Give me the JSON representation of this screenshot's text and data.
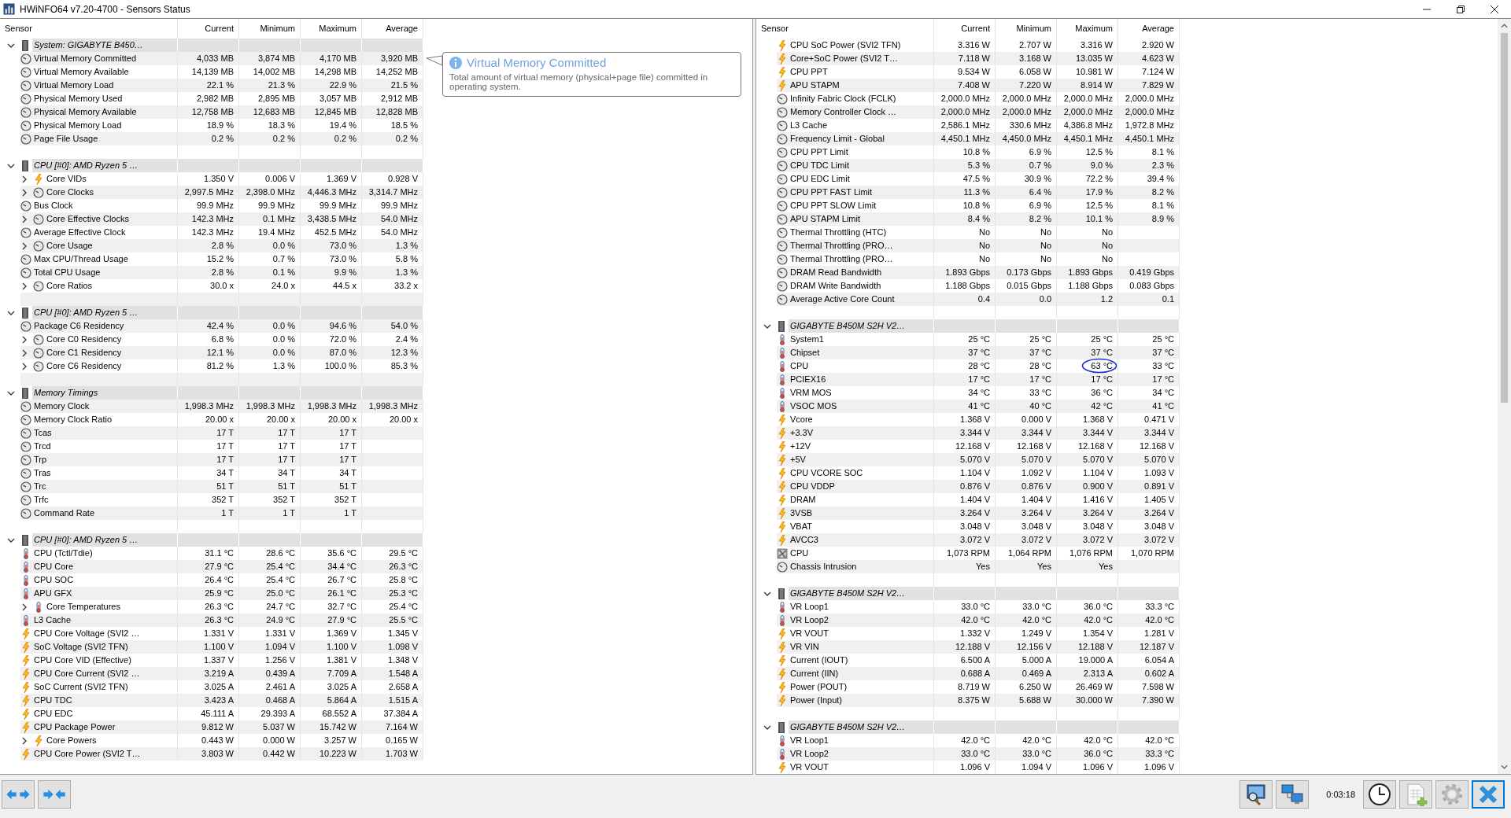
{
  "window": {
    "title": "HWiNFO64 v7.20-4700 - Sensors Status"
  },
  "panes": [
    {
      "columns": [
        "Sensor",
        "Current",
        "Minimum",
        "Maximum",
        "Average"
      ],
      "tooltip": {
        "title": "Virtual Memory Committed",
        "text": "Total amount of virtual memory (physical+page file) committed in operating system."
      },
      "groups": [
        {
          "title": "System: GIGABYTE B450…",
          "expanded": true,
          "rows": [
            {
              "label": "Virtual Memory Committed",
              "kind": "clock",
              "expandable": false,
              "values": [
                "4,033 MB",
                "3,874 MB",
                "4,170 MB",
                "3,920 MB"
              ]
            },
            {
              "label": "Virtual Memory Available",
              "kind": "clock",
              "expandable": false,
              "values": [
                "14,139 MB",
                "14,002 MB",
                "14,298 MB",
                "14,252 MB"
              ]
            },
            {
              "label": "Virtual Memory Load",
              "kind": "clock",
              "expandable": false,
              "values": [
                "22.1 %",
                "21.3 %",
                "22.9 %",
                "21.5 %"
              ]
            },
            {
              "label": "Physical Memory Used",
              "kind": "clock",
              "expandable": false,
              "values": [
                "2,982 MB",
                "2,895 MB",
                "3,057 MB",
                "2,912 MB"
              ]
            },
            {
              "label": "Physical Memory Available",
              "kind": "clock",
              "expandable": false,
              "values": [
                "12,758 MB",
                "12,683 MB",
                "12,845 MB",
                "12,828 MB"
              ]
            },
            {
              "label": "Physical Memory Load",
              "kind": "clock",
              "expandable": false,
              "values": [
                "18.9 %",
                "18.3 %",
                "19.4 %",
                "18.5 %"
              ]
            },
            {
              "label": "Page File Usage",
              "kind": "clock",
              "expandable": false,
              "values": [
                "0.2 %",
                "0.2 %",
                "0.2 %",
                "0.2 %"
              ]
            }
          ]
        },
        {
          "title": "CPU [#0]: AMD Ryzen 5 …",
          "expanded": true,
          "rows": [
            {
              "label": "Core VIDs",
              "kind": "bolt",
              "expandable": true,
              "values": [
                "1.350 V",
                "0.006 V",
                "1.369 V",
                "0.928 V"
              ]
            },
            {
              "label": "Core Clocks",
              "kind": "clock",
              "expandable": true,
              "values": [
                "2,997.5 MHz",
                "2,398.0 MHz",
                "4,446.3 MHz",
                "3,314.7 MHz"
              ]
            },
            {
              "label": "Bus Clock",
              "kind": "clock",
              "expandable": false,
              "values": [
                "99.9 MHz",
                "99.9 MHz",
                "99.9 MHz",
                "99.9 MHz"
              ]
            },
            {
              "label": "Core Effective Clocks",
              "kind": "clock",
              "expandable": true,
              "values": [
                "142.3 MHz",
                "0.1 MHz",
                "3,438.5 MHz",
                "54.0 MHz"
              ]
            },
            {
              "label": "Average Effective Clock",
              "kind": "clock",
              "expandable": false,
              "values": [
                "142.3 MHz",
                "19.4 MHz",
                "452.5 MHz",
                "54.0 MHz"
              ]
            },
            {
              "label": "Core Usage",
              "kind": "clock",
              "expandable": true,
              "values": [
                "2.8 %",
                "0.0 %",
                "73.0 %",
                "1.3 %"
              ]
            },
            {
              "label": "Max CPU/Thread Usage",
              "kind": "clock",
              "expandable": false,
              "values": [
                "15.2 %",
                "0.7 %",
                "73.0 %",
                "5.8 %"
              ]
            },
            {
              "label": "Total CPU Usage",
              "kind": "clock",
              "expandable": false,
              "values": [
                "2.8 %",
                "0.1 %",
                "9.9 %",
                "1.3 %"
              ]
            },
            {
              "label": "Core Ratios",
              "kind": "clock",
              "expandable": true,
              "values": [
                "30.0 x",
                "24.0 x",
                "44.5 x",
                "33.2 x"
              ]
            }
          ]
        },
        {
          "title": "CPU [#0]: AMD Ryzen 5 …",
          "expanded": true,
          "rows": [
            {
              "label": "Package C6 Residency",
              "kind": "clock",
              "expandable": false,
              "values": [
                "42.4 %",
                "0.0 %",
                "94.6 %",
                "54.0 %"
              ]
            },
            {
              "label": "Core C0 Residency",
              "kind": "clock",
              "expandable": true,
              "values": [
                "6.8 %",
                "0.0 %",
                "72.0 %",
                "2.4 %"
              ]
            },
            {
              "label": "Core C1 Residency",
              "kind": "clock",
              "expandable": true,
              "values": [
                "12.1 %",
                "0.0 %",
                "87.0 %",
                "12.3 %"
              ]
            },
            {
              "label": "Core C6 Residency",
              "kind": "clock",
              "expandable": true,
              "values": [
                "81.2 %",
                "1.3 %",
                "100.0 %",
                "85.3 %"
              ]
            }
          ]
        },
        {
          "title": "Memory Timings",
          "expanded": true,
          "rows": [
            {
              "label": "Memory Clock",
              "kind": "clock",
              "expandable": false,
              "values": [
                "1,998.3 MHz",
                "1,998.3 MHz",
                "1,998.3 MHz",
                "1,998.3 MHz"
              ]
            },
            {
              "label": "Memory Clock Ratio",
              "kind": "clock",
              "expandable": false,
              "values": [
                "20.00 x",
                "20.00 x",
                "20.00 x",
                "20.00 x"
              ]
            },
            {
              "label": "Tcas",
              "kind": "clock",
              "expandable": false,
              "values": [
                "17 T",
                "17 T",
                "17 T"
              ]
            },
            {
              "label": "Trcd",
              "kind": "clock",
              "expandable": false,
              "values": [
                "17 T",
                "17 T",
                "17 T"
              ]
            },
            {
              "label": "Trp",
              "kind": "clock",
              "expandable": false,
              "values": [
                "17 T",
                "17 T",
                "17 T"
              ]
            },
            {
              "label": "Tras",
              "kind": "clock",
              "expandable": false,
              "values": [
                "34 T",
                "34 T",
                "34 T"
              ]
            },
            {
              "label": "Trc",
              "kind": "clock",
              "expandable": false,
              "values": [
                "51 T",
                "51 T",
                "51 T"
              ]
            },
            {
              "label": "Trfc",
              "kind": "clock",
              "expandable": false,
              "values": [
                "352 T",
                "352 T",
                "352 T"
              ]
            },
            {
              "label": "Command Rate",
              "kind": "clock",
              "expandable": false,
              "values": [
                "1 T",
                "1 T",
                "1 T"
              ]
            }
          ]
        },
        {
          "title": "CPU [#0]: AMD Ryzen 5 …",
          "expanded": true,
          "rows": [
            {
              "label": "CPU (Tctl/Tdie)",
              "kind": "thermo",
              "expandable": false,
              "values": [
                "31.1 °C",
                "28.6 °C",
                "35.6 °C",
                "29.5 °C"
              ]
            },
            {
              "label": "CPU Core",
              "kind": "thermo",
              "expandable": false,
              "values": [
                "27.9 °C",
                "25.4 °C",
                "34.4 °C",
                "26.3 °C"
              ]
            },
            {
              "label": "CPU SOC",
              "kind": "thermo",
              "expandable": false,
              "values": [
                "26.4 °C",
                "25.4 °C",
                "26.7 °C",
                "25.8 °C"
              ]
            },
            {
              "label": "APU GFX",
              "kind": "thermo",
              "expandable": false,
              "values": [
                "25.9 °C",
                "25.0 °C",
                "26.1 °C",
                "25.3 °C"
              ]
            },
            {
              "label": "Core Temperatures",
              "kind": "thermo",
              "expandable": true,
              "values": [
                "26.3 °C",
                "24.7 °C",
                "32.7 °C",
                "25.4 °C"
              ]
            },
            {
              "label": "L3 Cache",
              "kind": "thermo",
              "expandable": false,
              "values": [
                "26.3 °C",
                "24.9 °C",
                "27.9 °C",
                "25.5 °C"
              ]
            },
            {
              "label": "CPU Core Voltage (SVI2 …",
              "kind": "bolt",
              "expandable": false,
              "values": [
                "1.331 V",
                "1.331 V",
                "1.369 V",
                "1.345 V"
              ]
            },
            {
              "label": "SoC Voltage (SVI2 TFN)",
              "kind": "bolt",
              "expandable": false,
              "values": [
                "1.100 V",
                "1.094 V",
                "1.100 V",
                "1.098 V"
              ]
            },
            {
              "label": "CPU Core VID (Effective)",
              "kind": "bolt",
              "expandable": false,
              "values": [
                "1.337 V",
                "1.256 V",
                "1.381 V",
                "1.348 V"
              ]
            },
            {
              "label": "CPU Core Current (SVI2 …",
              "kind": "bolt",
              "expandable": false,
              "values": [
                "3.219 A",
                "0.439 A",
                "7.709 A",
                "1.548 A"
              ]
            },
            {
              "label": "SoC Current (SVI2 TFN)",
              "kind": "bolt",
              "expandable": false,
              "values": [
                "3.025 A",
                "2.461 A",
                "3.025 A",
                "2.658 A"
              ]
            },
            {
              "label": "CPU TDC",
              "kind": "bolt",
              "expandable": false,
              "values": [
                "3.423 A",
                "0.468 A",
                "5.864 A",
                "1.515 A"
              ]
            },
            {
              "label": "CPU EDC",
              "kind": "bolt",
              "expandable": false,
              "values": [
                "45.111 A",
                "29.393 A",
                "68.552 A",
                "37.384 A"
              ]
            },
            {
              "label": "CPU Package Power",
              "kind": "bolt",
              "expandable": false,
              "values": [
                "9.812 W",
                "5.037 W",
                "15.742 W",
                "7.164 W"
              ]
            },
            {
              "label": "Core Powers",
              "kind": "bolt",
              "expandable": true,
              "values": [
                "0.443 W",
                "0.000 W",
                "3.257 W",
                "0.165 W"
              ]
            },
            {
              "label": "CPU Core Power (SVI2 T…",
              "kind": "bolt",
              "expandable": false,
              "values": [
                "3.803 W",
                "0.442 W",
                "10.223 W",
                "1.703 W"
              ]
            }
          ]
        }
      ]
    },
    {
      "columns": [
        "Sensor",
        "Current",
        "Minimum",
        "Maximum",
        "Average"
      ],
      "groups": [
        {
          "rows": [
            {
              "label": "CPU SoC Power (SVI2 TFN)",
              "kind": "bolt",
              "expandable": false,
              "values": [
                "3.316 W",
                "2.707 W",
                "3.316 W",
                "2.920 W"
              ]
            },
            {
              "label": "Core+SoC Power (SVI2 T…",
              "kind": "bolt",
              "expandable": false,
              "values": [
                "7.118 W",
                "3.168 W",
                "13.035 W",
                "4.623 W"
              ]
            },
            {
              "label": "CPU PPT",
              "kind": "bolt",
              "expandable": false,
              "values": [
                "9.534 W",
                "6.058 W",
                "10.981 W",
                "7.124 W"
              ]
            },
            {
              "label": "APU STAPM",
              "kind": "bolt",
              "expandable": false,
              "values": [
                "7.408 W",
                "7.220 W",
                "8.914 W",
                "7.829 W"
              ]
            },
            {
              "label": "Infinity Fabric Clock (FCLK)",
              "kind": "clock",
              "expandable": false,
              "values": [
                "2,000.0 MHz",
                "2,000.0 MHz",
                "2,000.0 MHz",
                "2,000.0 MHz"
              ]
            },
            {
              "label": "Memory Controller Clock …",
              "kind": "clock",
              "expandable": false,
              "values": [
                "2,000.0 MHz",
                "2,000.0 MHz",
                "2,000.0 MHz",
                "2,000.0 MHz"
              ]
            },
            {
              "label": "L3 Cache",
              "kind": "clock",
              "expandable": false,
              "values": [
                "2,586.1 MHz",
                "330.6 MHz",
                "4,386.8 MHz",
                "1,972.8 MHz"
              ]
            },
            {
              "label": "Frequency Limit - Global",
              "kind": "clock",
              "expandable": false,
              "values": [
                "4,450.1 MHz",
                "4,450.0 MHz",
                "4,450.1 MHz",
                "4,450.1 MHz"
              ]
            },
            {
              "label": "CPU PPT Limit",
              "kind": "clock",
              "expandable": false,
              "values": [
                "10.8 %",
                "6.9 %",
                "12.5 %",
                "8.1 %"
              ]
            },
            {
              "label": "CPU TDC Limit",
              "kind": "clock",
              "expandable": false,
              "values": [
                "5.3 %",
                "0.7 %",
                "9.0 %",
                "2.3 %"
              ]
            },
            {
              "label": "CPU EDC Limit",
              "kind": "clock",
              "expandable": false,
              "values": [
                "47.5 %",
                "30.9 %",
                "72.2 %",
                "39.4 %"
              ]
            },
            {
              "label": "CPU PPT FAST Limit",
              "kind": "clock",
              "expandable": false,
              "values": [
                "11.3 %",
                "6.4 %",
                "17.9 %",
                "8.2 %"
              ]
            },
            {
              "label": "CPU PPT SLOW Limit",
              "kind": "clock",
              "expandable": false,
              "values": [
                "10.8 %",
                "6.9 %",
                "12.5 %",
                "8.1 %"
              ]
            },
            {
              "label": "APU STAPM Limit",
              "kind": "clock",
              "expandable": false,
              "values": [
                "8.4 %",
                "8.2 %",
                "10.1 %",
                "8.9 %"
              ]
            },
            {
              "label": "Thermal Throttling (HTC)",
              "kind": "clock",
              "expandable": false,
              "values": [
                "No",
                "No",
                "No"
              ]
            },
            {
              "label": "Thermal Throttling (PRO…",
              "kind": "clock",
              "expandable": false,
              "values": [
                "No",
                "No",
                "No"
              ]
            },
            {
              "label": "Thermal Throttling (PRO…",
              "kind": "clock",
              "expandable": false,
              "values": [
                "No",
                "No",
                "No"
              ]
            },
            {
              "label": "DRAM Read Bandwidth",
              "kind": "clock",
              "expandable": false,
              "values": [
                "1.893 Gbps",
                "0.173 Gbps",
                "1.893 Gbps",
                "0.419 Gbps"
              ]
            },
            {
              "label": "DRAM Write Bandwidth",
              "kind": "clock",
              "expandable": false,
              "values": [
                "1.188 Gbps",
                "0.015 Gbps",
                "1.188 Gbps",
                "0.083 Gbps"
              ]
            },
            {
              "label": "Average Active Core Count",
              "kind": "clock",
              "expandable": false,
              "values": [
                "0.4",
                "0.0",
                "1.2",
                "0.1"
              ]
            }
          ]
        },
        {
          "title": "GIGABYTE B450M S2H V2…",
          "expanded": true,
          "rows": [
            {
              "label": "System1",
              "kind": "thermo",
              "expandable": false,
              "values": [
                "25 °C",
                "25 °C",
                "25 °C",
                "25 °C"
              ]
            },
            {
              "label": "Chipset",
              "kind": "thermo",
              "expandable": false,
              "values": [
                "37 °C",
                "37 °C",
                "37 °C",
                "37 °C"
              ]
            },
            {
              "label": "CPU",
              "kind": "thermo",
              "expandable": false,
              "circled": true,
              "values": [
                "28 °C",
                "28 °C",
                "63 °C",
                "33 °C"
              ]
            },
            {
              "label": "PCIEX16",
              "kind": "thermo",
              "expandable": false,
              "values": [
                "17 °C",
                "17 °C",
                "17 °C",
                "17 °C"
              ]
            },
            {
              "label": "VRM MOS",
              "kind": "thermo",
              "expandable": false,
              "values": [
                "34 °C",
                "33 °C",
                "36 °C",
                "34 °C"
              ]
            },
            {
              "label": "VSOC MOS",
              "kind": "thermo",
              "expandable": false,
              "values": [
                "41 °C",
                "40 °C",
                "42 °C",
                "41 °C"
              ]
            },
            {
              "label": "Vcore",
              "kind": "bolt",
              "expandable": false,
              "values": [
                "1.368 V",
                "0.000 V",
                "1.368 V",
                "0.471 V"
              ]
            },
            {
              "label": "+3.3V",
              "kind": "bolt",
              "expandable": false,
              "values": [
                "3.344 V",
                "3.344 V",
                "3.344 V",
                "3.344 V"
              ]
            },
            {
              "label": "+12V",
              "kind": "bolt",
              "expandable": false,
              "values": [
                "12.168 V",
                "12.168 V",
                "12.168 V",
                "12.168 V"
              ]
            },
            {
              "label": "+5V",
              "kind": "bolt",
              "expandable": false,
              "values": [
                "5.070 V",
                "5.070 V",
                "5.070 V",
                "5.070 V"
              ]
            },
            {
              "label": "CPU VCORE SOC",
              "kind": "bolt",
              "expandable": false,
              "values": [
                "1.104 V",
                "1.092 V",
                "1.104 V",
                "1.093 V"
              ]
            },
            {
              "label": "CPU VDDP",
              "kind": "bolt",
              "expandable": false,
              "values": [
                "0.876 V",
                "0.876 V",
                "0.900 V",
                "0.891 V"
              ]
            },
            {
              "label": "DRAM",
              "kind": "bolt",
              "expandable": false,
              "values": [
                "1.404 V",
                "1.404 V",
                "1.416 V",
                "1.405 V"
              ]
            },
            {
              "label": "3VSB",
              "kind": "bolt",
              "expandable": false,
              "values": [
                "3.264 V",
                "3.264 V",
                "3.264 V",
                "3.264 V"
              ]
            },
            {
              "label": "VBAT",
              "kind": "bolt",
              "expandable": false,
              "values": [
                "3.048 V",
                "3.048 V",
                "3.048 V",
                "3.048 V"
              ]
            },
            {
              "label": "AVCC3",
              "kind": "bolt",
              "expandable": false,
              "values": [
                "3.072 V",
                "3.072 V",
                "3.072 V",
                "3.072 V"
              ]
            },
            {
              "label": "CPU",
              "kind": "fan",
              "expandable": false,
              "values": [
                "1,073 RPM",
                "1,064 RPM",
                "1,076 RPM",
                "1,070 RPM"
              ]
            },
            {
              "label": "Chassis Intrusion",
              "kind": "clock",
              "expandable": false,
              "values": [
                "Yes",
                "Yes",
                "Yes"
              ]
            }
          ]
        },
        {
          "title": "GIGABYTE B450M S2H V2…",
          "expanded": true,
          "rows": [
            {
              "label": "VR Loop1",
              "kind": "thermo",
              "expandable": false,
              "values": [
                "33.0 °C",
                "33.0 °C",
                "36.0 °C",
                "33.3 °C"
              ]
            },
            {
              "label": "VR Loop2",
              "kind": "thermo",
              "expandable": false,
              "values": [
                "42.0 °C",
                "42.0 °C",
                "42.0 °C",
                "42.0 °C"
              ]
            },
            {
              "label": "VR VOUT",
              "kind": "bolt",
              "expandable": false,
              "values": [
                "1.332 V",
                "1.249 V",
                "1.354 V",
                "1.281 V"
              ]
            },
            {
              "label": "VR VIN",
              "kind": "bolt",
              "expandable": false,
              "values": [
                "12.188 V",
                "12.156 V",
                "12.188 V",
                "12.187 V"
              ]
            },
            {
              "label": "Current (IOUT)",
              "kind": "bolt",
              "expandable": false,
              "values": [
                "6.500 A",
                "5.000 A",
                "19.000 A",
                "6.054 A"
              ]
            },
            {
              "label": "Current (IIN)",
              "kind": "bolt",
              "expandable": false,
              "values": [
                "0.688 A",
                "0.469 A",
                "2.313 A",
                "0.602 A"
              ]
            },
            {
              "label": "Power (POUT)",
              "kind": "bolt",
              "expandable": false,
              "values": [
                "8.719 W",
                "6.250 W",
                "26.469 W",
                "7.598 W"
              ]
            },
            {
              "label": "Power (Input)",
              "kind": "bolt",
              "expandable": false,
              "values": [
                "8.375 W",
                "5.688 W",
                "30.000 W",
                "7.390 W"
              ]
            }
          ]
        },
        {
          "title": "GIGABYTE B450M S2H V2…",
          "expanded": true,
          "rows": [
            {
              "label": "VR Loop1",
              "kind": "thermo",
              "expandable": false,
              "values": [
                "42.0 °C",
                "42.0 °C",
                "42.0 °C",
                "42.0 °C"
              ]
            },
            {
              "label": "VR Loop2",
              "kind": "thermo",
              "expandable": false,
              "values": [
                "33.0 °C",
                "33.0 °C",
                "36.0 °C",
                "33.3 °C"
              ]
            },
            {
              "label": "VR VOUT",
              "kind": "bolt",
              "expandable": false,
              "values": [
                "1.096 V",
                "1.094 V",
                "1.096 V",
                "1.096 V"
              ]
            }
          ]
        }
      ]
    }
  ],
  "status_bar": {
    "elapsed": "0:03:18"
  }
}
